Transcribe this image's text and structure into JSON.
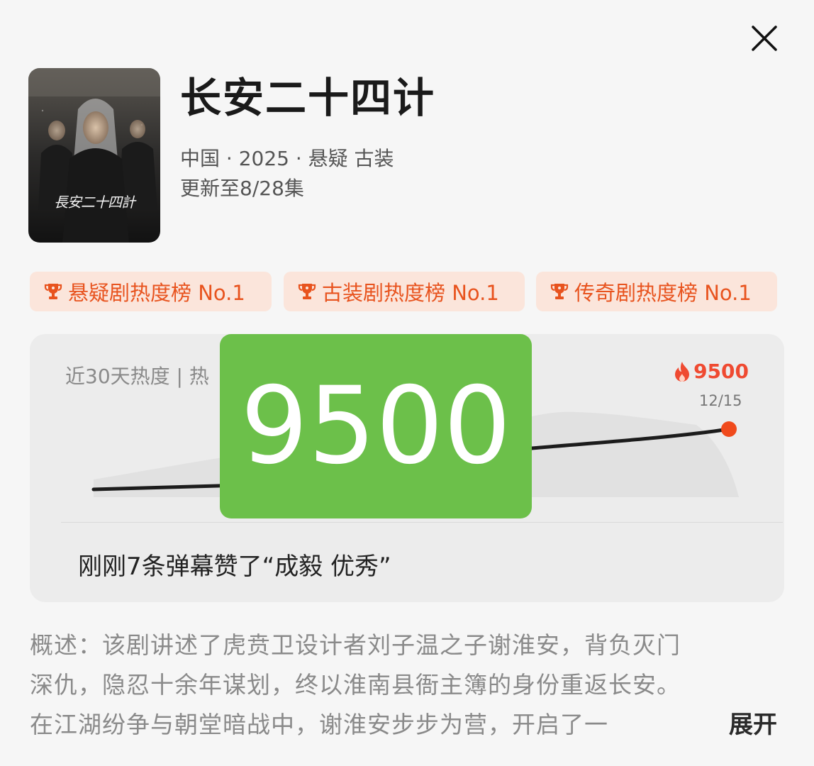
{
  "header": {
    "title": "长安二十四计",
    "meta": "中国 · 2025 · 悬疑 古装",
    "update": "更新至8/28集",
    "poster_text": "長安二十四計"
  },
  "close_icon": "close-icon",
  "rank_badges": [
    {
      "label": "悬疑剧热度榜 No.1",
      "icon": "trophy-icon"
    },
    {
      "label": "古装剧热度榜 No.1",
      "icon": "trophy-icon"
    },
    {
      "label": "传奇剧热度榜 No.1",
      "icon": "trophy-icon"
    }
  ],
  "heat": {
    "label": "近30天热度 | 热",
    "current_value": "9500",
    "current_date": "12/15",
    "flame_icon": "flame-icon",
    "barrage": "刚刚7条弹幕赞了“成毅 优秀”"
  },
  "overlay_badge": "9500",
  "synopsis": {
    "lines": [
      "概述：该剧讲述了虎贲卫设计者刘子温之子谢淮安，背负灭门",
      "深仇，隐忍十余年谋划，终以淮南县衙主簿的身份重返长安。",
      "在江湖纷争与朝堂暗战中，谢淮安步步为营，开启了一"
    ],
    "expand": "展开"
  },
  "colors": {
    "accent": "#e8531e",
    "badge_bg": "#fbe5db",
    "heat_red": "#ef4a31",
    "overlay_green": "#6cc04a"
  }
}
